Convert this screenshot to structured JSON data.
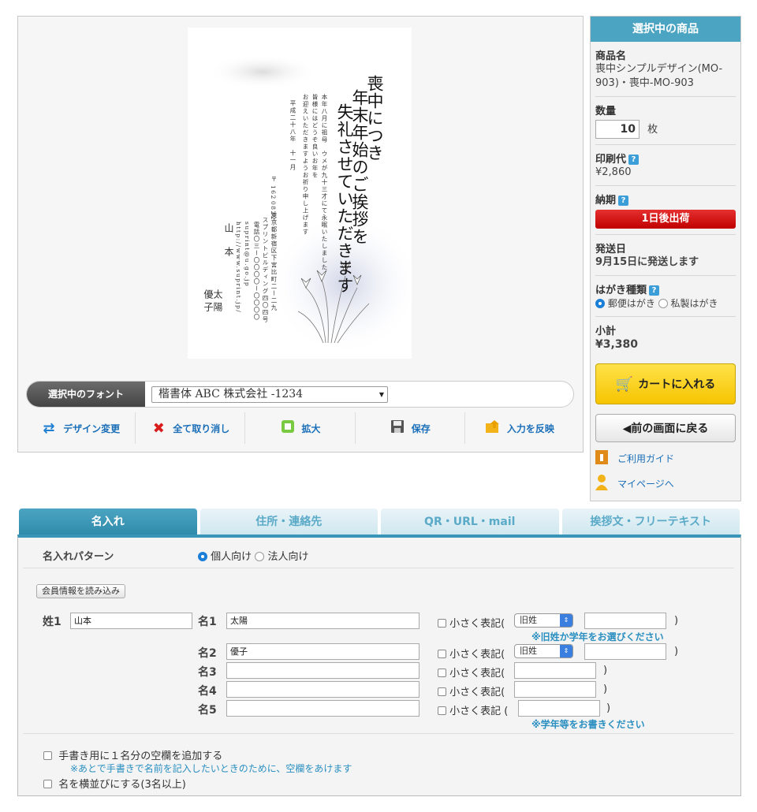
{
  "preview": {
    "card": {
      "greeting_line1": "喪中につき",
      "greeting_line2": "年末年始のご挨拶を",
      "greeting_line3": "失礼させていただきます",
      "body_line1": "本年八月に祖母　ウメが九十三才にて永眠いたしました",
      "body_line2": "皆様にはどうぞ良いお年を",
      "body_line3": "お迎えいただきますようお祈り申し上げます",
      "date": "平成二十八年　十一月",
      "postal_mark": "〒",
      "postal_code1": "162",
      "postal_code2": "0822",
      "address1": "東京都新宿区下宮比町二ー二九",
      "address2": "スプリントビルディング四〇四号",
      "tel": "電話〇三ー〇〇〇〇ー〇〇〇〇",
      "email": "suprint@u.go.jp",
      "url": "http://www.suprint.jp/",
      "surname": "山本",
      "name1": "太陽",
      "name2": "優子"
    },
    "font_label": "選択中のフォント",
    "font_value": "楷書体 ABC 株式会社 -1234",
    "toolbar": [
      {
        "label": "デザイン変更",
        "icon": "swap-arrows-icon"
      },
      {
        "label": "全て取り消し",
        "icon": "red-x-icon"
      },
      {
        "label": "拡大",
        "icon": "zoom-icon"
      },
      {
        "label": "保存",
        "icon": "save-icon"
      },
      {
        "label": "入力を反映",
        "icon": "apply-icon"
      }
    ]
  },
  "sidebar": {
    "title": "選択中の商品",
    "product_label": "商品名",
    "product_name": "喪中シンプルデザイン(MO-903)・喪中-MO-903",
    "qty_label": "数量",
    "qty_value": "10",
    "qty_unit": "枚",
    "price_label": "印刷代",
    "price_value": "¥2,860",
    "delivery_label": "納期",
    "delivery_badge": "1日後出荷",
    "ship_label": "発送日",
    "ship_value": "9月15日に発送します",
    "postcard_label": "はがき種類",
    "postcard_opt1": "郵便はがき",
    "postcard_opt2": "私製はがき",
    "subtotal_label": "小計",
    "subtotal_value": "¥3,380",
    "cart_button": "カートに入れる",
    "back_button": "◀前の画面に戻る",
    "guide_link": "ご利用ガイド",
    "mypage_link": "マイページへ",
    "help_mark": "?"
  },
  "tabs": [
    "名入れ",
    "住所・連絡先",
    "QR・URL・mail",
    "挨拶文・フリーテキスト"
  ],
  "form": {
    "pattern_label": "名入れパターン",
    "pattern_opt1": "個人向け",
    "pattern_opt2": "法人向け",
    "load_button": "会員情報を読み込み",
    "surname_label": "姓1",
    "surname_value": "山本",
    "rows": [
      {
        "label": "名1",
        "value": "太陽",
        "small": "小さく表記(",
        "select": "旧姓"
      },
      {
        "label": "名2",
        "value": "優子",
        "small": "小さく表記(",
        "select": "旧姓"
      },
      {
        "label": "名3",
        "value": "",
        "small": "小さく表記("
      },
      {
        "label": "名4",
        "value": "",
        "small": "小さく表記("
      },
      {
        "label": "名5",
        "value": "",
        "small": "小さく表記 ("
      }
    ],
    "close_paren": ")",
    "note1": "※旧姓か学年をお選びください",
    "note2": "※学年等をお書きください",
    "option1": "手書き用に１名分の空欄を追加する",
    "option1_note": "※あとで手書きで名前を記入したいときのために、空欄をあけます",
    "option2": "名を横並びにする(3名以上)"
  }
}
